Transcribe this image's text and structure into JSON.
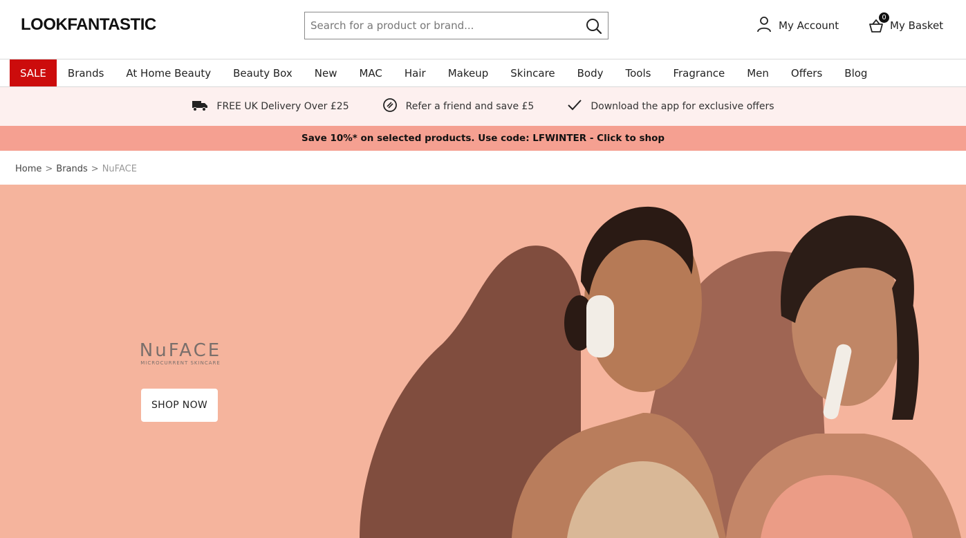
{
  "header": {
    "logo": "LOOKFANTASTIC",
    "search_placeholder": "Search for a product or brand...",
    "search_icon": "search-icon",
    "account_label": "My Account",
    "account_icon": "user-icon",
    "basket_label": "My Basket",
    "basket_count": "0",
    "basket_icon": "basket-icon"
  },
  "nav": {
    "items": [
      "SALE",
      "Brands",
      "At Home Beauty",
      "Beauty Box",
      "New",
      "MAC",
      "Hair",
      "Makeup",
      "Skincare",
      "Body",
      "Tools",
      "Fragrance",
      "Men",
      "Offers",
      "Blog"
    ],
    "sale_color": "#cc0c0c"
  },
  "usp": {
    "delivery": "FREE UK Delivery Over £25",
    "refer": "Refer a friend and save £5",
    "app": "Download the app for exclusive offers",
    "delivery_icon": "truck-icon",
    "refer_icon": "refer-icon",
    "app_icon": "checkmark-icon"
  },
  "promo": {
    "text": "Save 10%* on selected products. Use code: LFWINTER - Click to shop",
    "color": "#f5a091"
  },
  "breadcrumb": {
    "home": "Home",
    "brands": "Brands",
    "current": "NuFACE",
    "separator": ">"
  },
  "hero": {
    "brand_logo": "NuFACE",
    "brand_tagline": "MICROCURRENT SKINCARE",
    "cta": "SHOP NOW",
    "background": "#f5b49d"
  }
}
